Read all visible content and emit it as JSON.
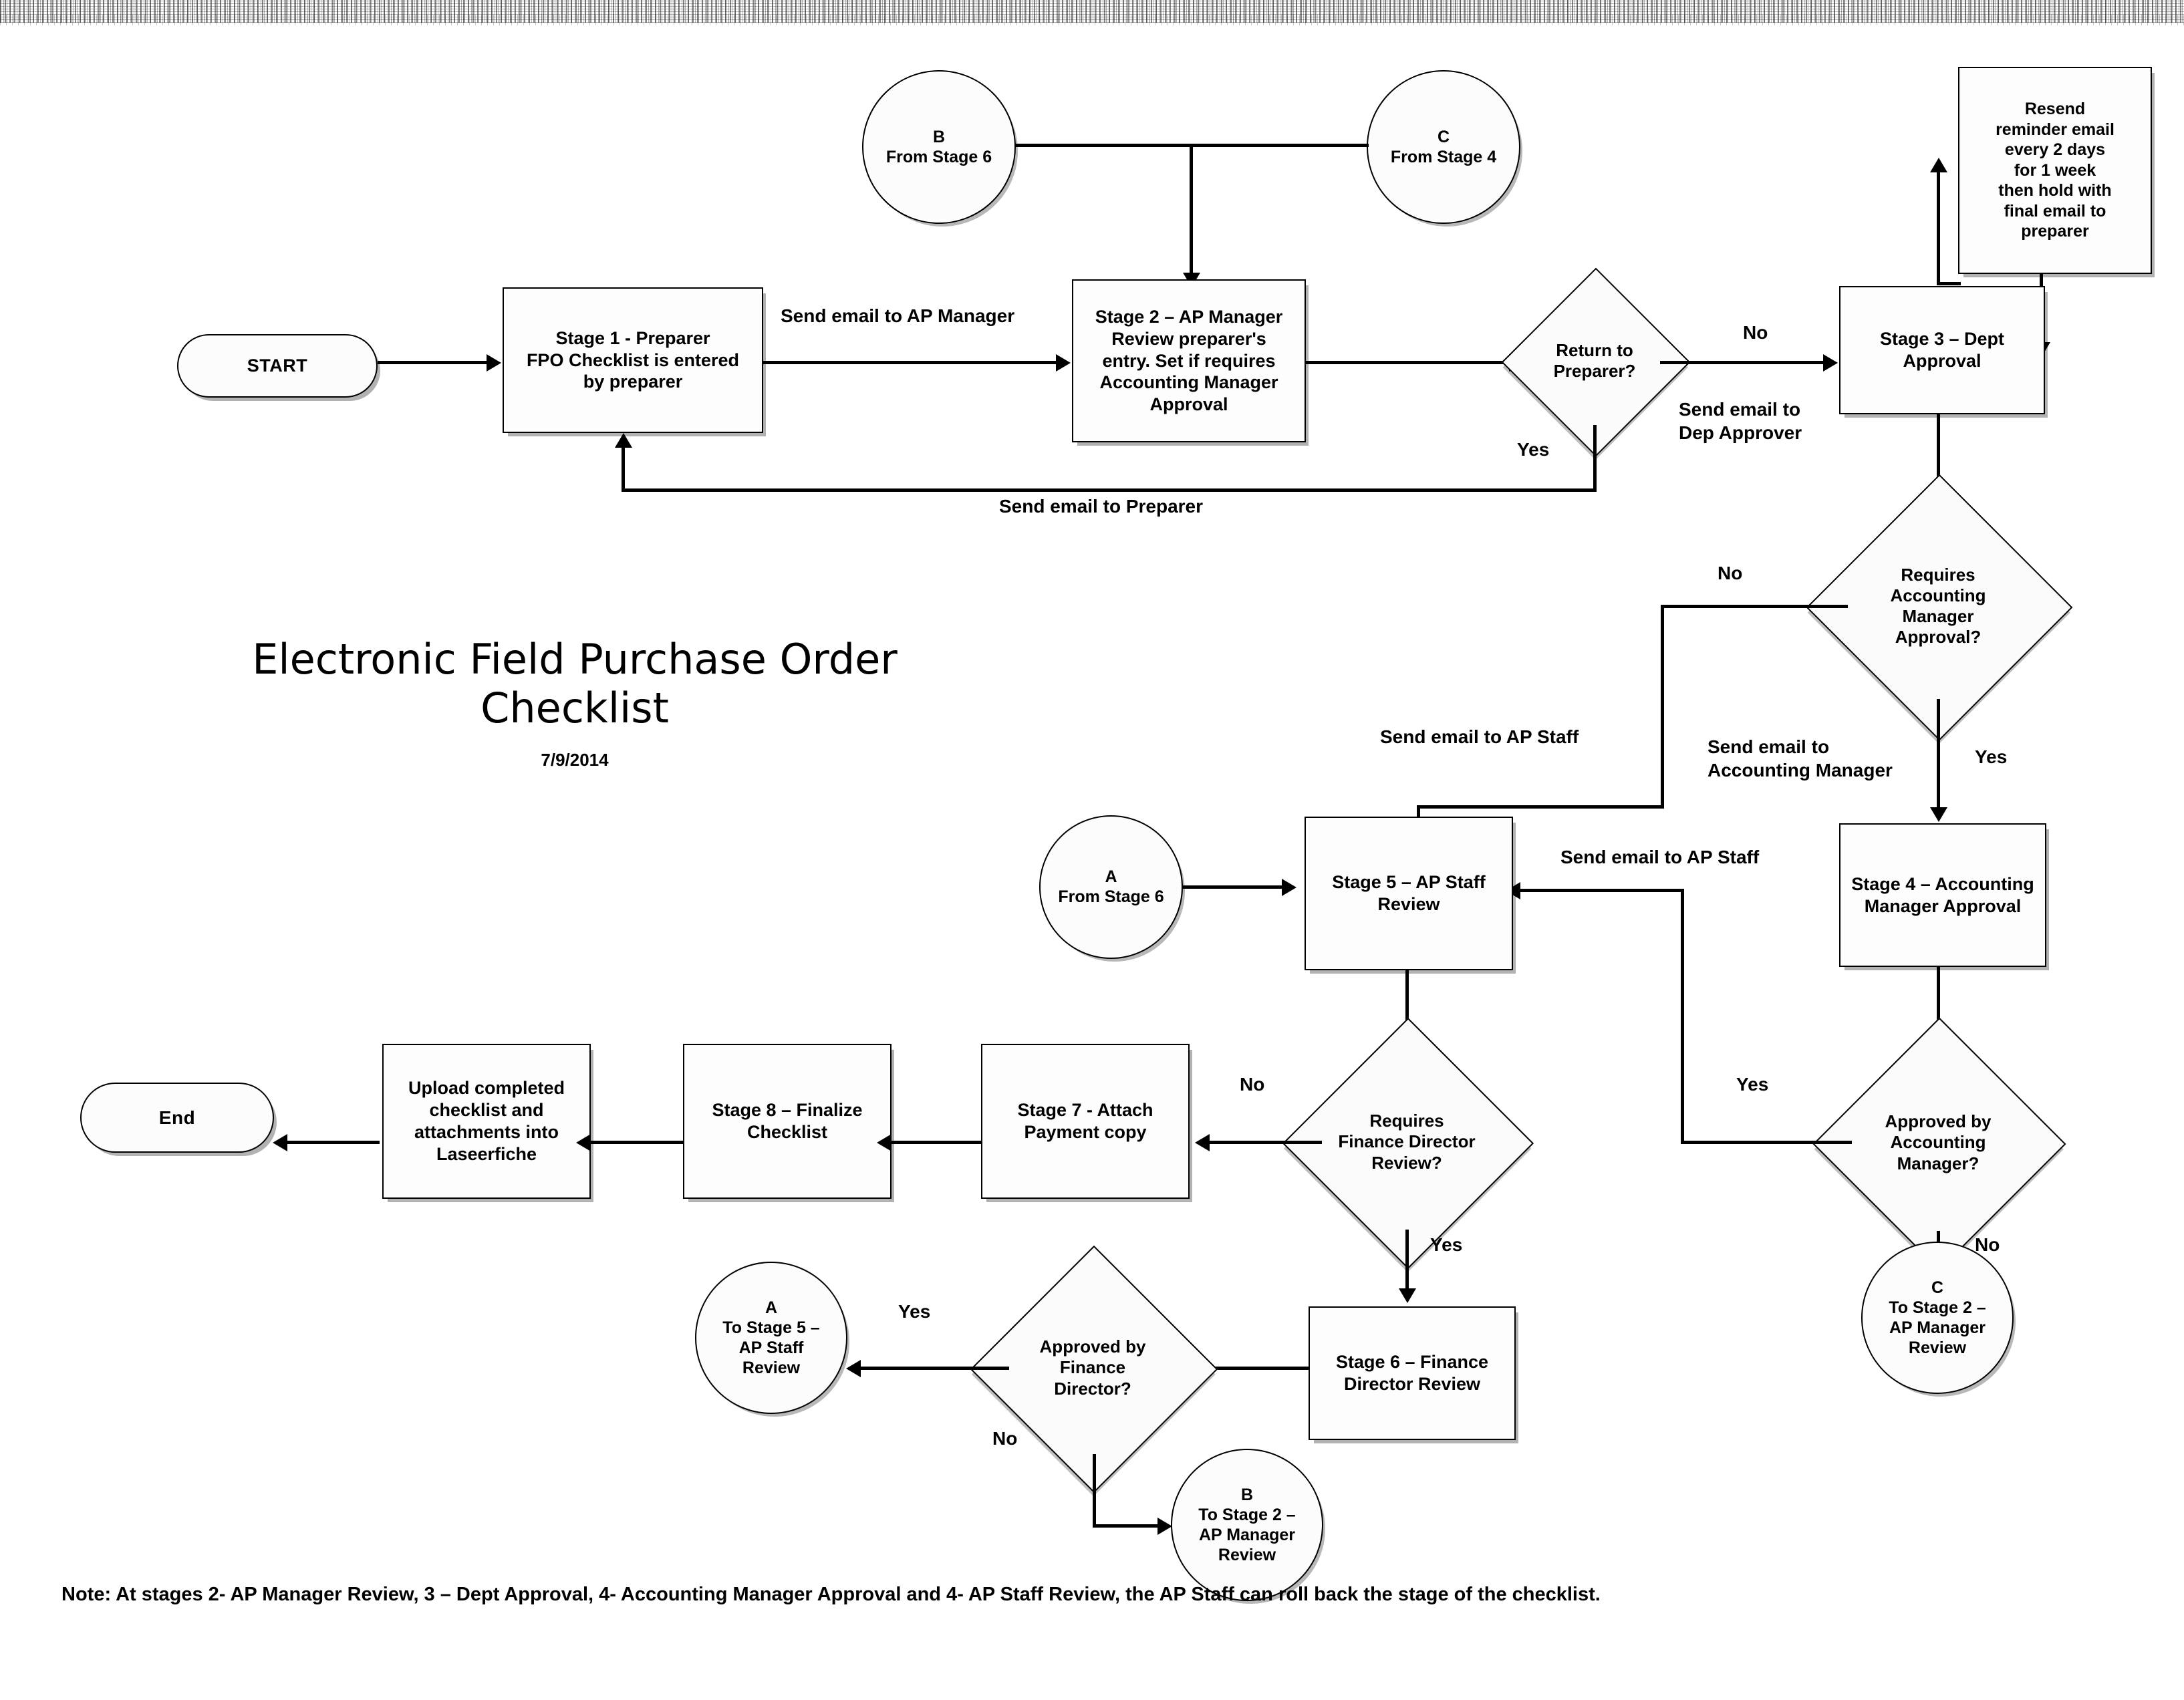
{
  "title": {
    "heading": "Electronic Field Purchase Order\nChecklist",
    "date": "7/9/2014"
  },
  "footnote": "Note: At stages 2- AP Manager Review, 3 – Dept Approval, 4- Accounting Manager Approval and 4- AP Staff Review, the AP Staff can roll back the stage of the checklist.",
  "nodes": {
    "start": "START",
    "end": "End",
    "stage1": "Stage 1 - Preparer\nFPO Checklist is entered\nby preparer",
    "stage2": "Stage 2 – AP Manager\nReview preparer's\nentry. Set if requires\nAccounting Manager\nApproval",
    "stage3": "Stage 3 – Dept\nApproval",
    "stage4": "Stage 4 – Accounting\nManager Approval",
    "stage5": "Stage 5 – AP Staff\nReview",
    "stage6": "Stage 6 – Finance\nDirector Review",
    "stage7": "Stage 7 - Attach\nPayment copy",
    "stage8": "Stage 8 – Finalize\nChecklist",
    "resend": "Resend\nreminder email\nevery 2 days\nfor 1 week\nthen hold with\nfinal email to\npreparer",
    "upload": "Upload completed\nchecklist and\nattachments into\nLaseerfiche"
  },
  "decisions": {
    "return_to_preparer": "Return to\nPreparer?",
    "requires_acct_mgr": "Requires\nAccounting\nManager\nApproval?",
    "approved_by_acct_mgr": "Approved by\nAccounting\nManager?",
    "requires_fin_dir": "Requires\nFinance Director\nReview?",
    "approved_by_fin_dir": "Approved by\nFinance\nDirector?"
  },
  "connectors": {
    "b_top": {
      "tag": "B",
      "sub": "From Stage 6"
    },
    "c_top": {
      "tag": "C",
      "sub": "From Stage 4"
    },
    "a_mid": {
      "tag": "A",
      "sub": "From Stage 6"
    },
    "a_bottom": {
      "tag": "A",
      "sub": "To Stage 5 –\nAP Staff\nReview"
    },
    "b_bottom": {
      "tag": "B",
      "sub": "To Stage 2 –\nAP Manager\nReview"
    },
    "c_bottom": {
      "tag": "C",
      "sub": "To Stage 2 –\nAP Manager\nReview"
    }
  },
  "edge_labels": {
    "send_email_ap_manager": "Send email to AP Manager",
    "send_email_preparer": "Send email to Preparer",
    "send_email_dep_approver": "Send email to\nDep Approver",
    "send_email_acct_manager": "Send email to\nAccounting Manager",
    "send_email_ap_staff_top": "Send email to AP Staff",
    "send_email_ap_staff_right": "Send email to AP Staff",
    "no_return": "No",
    "yes_return": "Yes",
    "no_acct": "No",
    "yes_acct": "Yes",
    "yes_approved_acct": "Yes",
    "no_approved_acct": "No",
    "no_fin_dir": "No",
    "yes_fin_dir": "Yes",
    "yes_approved_fin": "Yes",
    "no_approved_fin": "No"
  },
  "colors": {
    "ink": "#000000",
    "paper": "#ffffff",
    "fill": "#fbfbfb"
  }
}
